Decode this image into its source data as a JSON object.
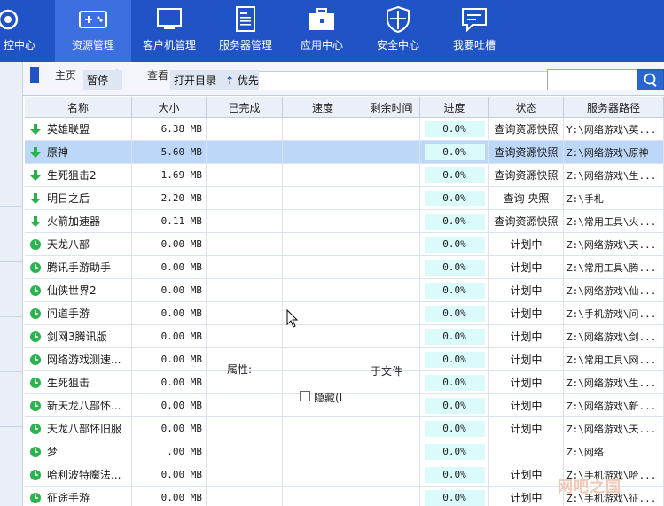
{
  "nav": {
    "items": [
      {
        "label": "控中心",
        "icon": "eye-icon"
      },
      {
        "label": "资源管理",
        "icon": "gamepad-icon",
        "active": true
      },
      {
        "label": "客户机管理",
        "icon": "monitor-icon"
      },
      {
        "label": "服务器管理",
        "icon": "server-doc-icon"
      },
      {
        "label": "应用中心",
        "icon": "toolbox-icon"
      },
      {
        "label": "安全中心",
        "icon": "shield-icon"
      },
      {
        "label": "我要吐槽",
        "icon": "chat-bubble-icon"
      }
    ]
  },
  "toolbar": {
    "home_label": "主页",
    "share_label": "享",
    "view_label": "查看",
    "pause_label": "暂停",
    "open_dir_label": "打开目录",
    "priority_label": "优先"
  },
  "table": {
    "headers": [
      "名称",
      "大小",
      "已完成",
      "速度",
      "剩余时间",
      "进度",
      "状态",
      "服务器路径"
    ],
    "rows": [
      {
        "icon": "download-arrow-icon",
        "name": "英雄联盟",
        "size": "6.38 MB",
        "progress": "0.0%",
        "status": "查询资源快照",
        "path": "Y:\\网络游戏\\英..."
      },
      {
        "icon": "download-arrow-icon",
        "name": "原神",
        "size": "5.60 MB",
        "progress": "0.0%",
        "status": "查询资源快照",
        "path": "Z:\\网络游戏\\原神",
        "selected": true
      },
      {
        "icon": "download-arrow-icon",
        "name": "生死狙击2",
        "size": "1.69 MB",
        "progress": "0.0%",
        "status": "查询资源快照",
        "path": "Z:\\网络游戏\\生..."
      },
      {
        "icon": "download-arrow-icon",
        "name": "明日之后",
        "size": "2.20 MB",
        "progress": "0.0%",
        "status": "查询    央照",
        "path": "Z:\\手札"
      },
      {
        "icon": "download-arrow-icon",
        "name": "火箭加速器",
        "size": "0.11 MB",
        "progress": "0.0%",
        "status": "查询资源快照",
        "path": "Z:\\常用工具\\火..."
      },
      {
        "icon": "clock-icon",
        "name": "天龙八部",
        "size": "0.00 MB",
        "progress": "0.0%",
        "status": "计划中",
        "path": "Z:\\网络游戏\\天..."
      },
      {
        "icon": "clock-icon",
        "name": "腾讯手游助手",
        "size": "0.00 MB",
        "progress": "0.0%",
        "status": "计划中",
        "path": "Z:\\常用工具\\腾..."
      },
      {
        "icon": "clock-icon",
        "name": "仙侠世界2",
        "size": "0.00 MB",
        "progress": "0.0%",
        "status": "计划中",
        "path": "Z:\\网络游戏\\仙..."
      },
      {
        "icon": "clock-icon",
        "name": "问道手游",
        "size": "0.00 MB",
        "progress": "0.0%",
        "status": "计划中",
        "path": "Z:\\手机游戏\\问..."
      },
      {
        "icon": "clock-icon",
        "name": "剑网3腾讯版",
        "size": "0.00 MB",
        "progress": "0.0%",
        "status": "计划中",
        "path": "Z:\\网络游戏\\剑..."
      },
      {
        "icon": "clock-icon",
        "name": "网络游戏测速...",
        "size": "0.00 MB",
        "progress": "0.0%",
        "status": "计划中",
        "path": "Z:\\常用工具\\网..."
      },
      {
        "icon": "clock-icon",
        "name": "生死狙击",
        "size": "0.00 MB",
        "progress": "0.0%",
        "status": "计划中",
        "path": "Z:\\网络游戏\\生..."
      },
      {
        "icon": "clock-icon",
        "name": "新天龙八部怀...",
        "size": "0.00 MB",
        "progress": "0.0%",
        "status": "计划中",
        "path": "Z:\\网络游戏\\新..."
      },
      {
        "icon": "clock-icon",
        "name": "天龙八部怀旧服",
        "size": "0.00 MB",
        "progress": "0.0%",
        "status": "计划中",
        "path": "Z:\\网络游戏\\天..."
      },
      {
        "icon": "clock-icon",
        "name": "梦",
        "size": ".00 MB",
        "progress": "0.0%",
        "status": "",
        "path": "Z:\\网络"
      },
      {
        "icon": "clock-icon",
        "name": "哈利波特魔法...",
        "size": "0.00 MB",
        "progress": "0.0%",
        "status": "计划中",
        "path": "Z:\\手机游戏\\哈..."
      },
      {
        "icon": "clock-icon",
        "name": "征途手游",
        "size": "0.00 MB",
        "progress": "0.0%",
        "status": "计划中",
        "path": "Z:\\手机游戏\\征..."
      }
    ]
  },
  "ghost": {
    "attr_label": "属性:",
    "file_label": "于文件",
    "hidden_label": "隐藏(I"
  },
  "watermark": "网吧之国",
  "colors": {
    "nav_bg": "#1f53c6",
    "nav_active": "#3d6fe0",
    "row_selected": "#bcd7f7",
    "progress_bg": "#dbfbfb",
    "download_green": "#27b24a",
    "clock_green": "#2bb34f"
  }
}
